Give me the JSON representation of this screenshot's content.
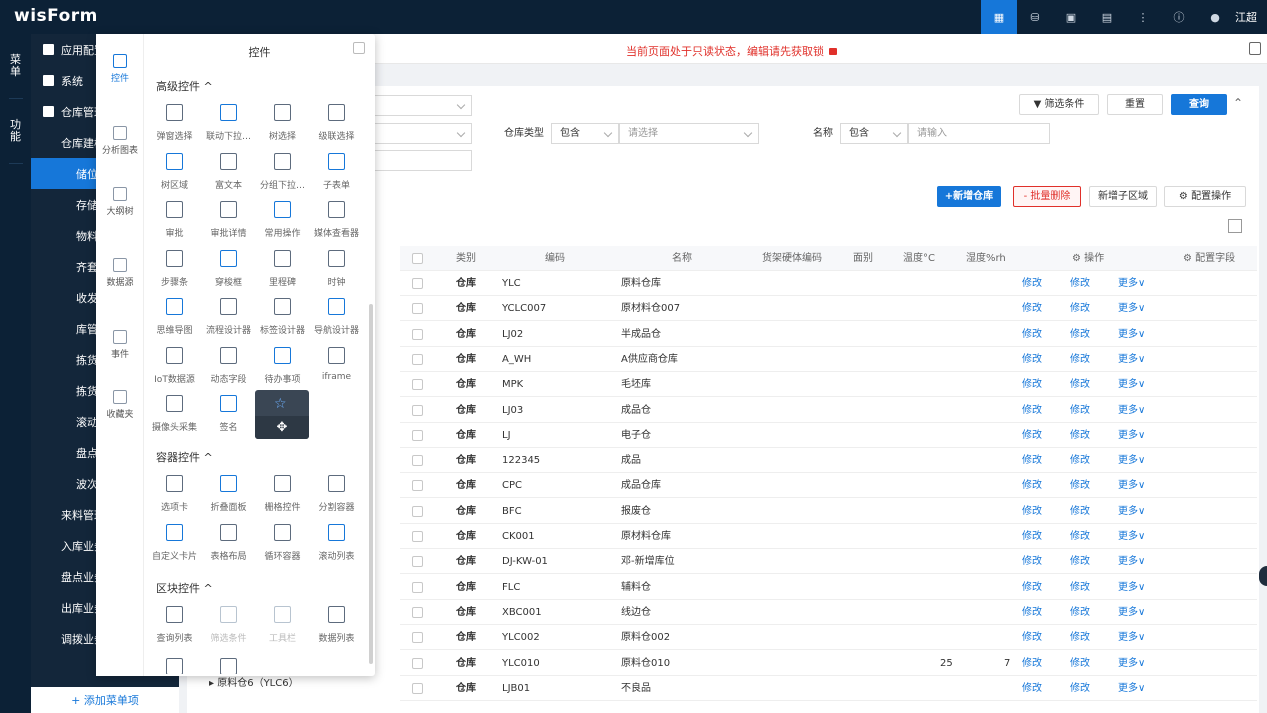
{
  "app": {
    "logo_main": "wis",
    "logo_second": "Form",
    "user_name": "江超"
  },
  "leftnav": [
    {
      "label": "菜单"
    },
    {
      "label": "功能"
    }
  ],
  "sidemenu": {
    "items": [
      {
        "label": "应用配置",
        "level": 1
      },
      {
        "label": "系统",
        "level": 1
      },
      {
        "label": "仓库管理",
        "level": 1
      },
      {
        "label": "仓库建模",
        "level": 2
      },
      {
        "label": "储位",
        "level": 3,
        "active": true
      },
      {
        "label": "存储",
        "level": 3
      },
      {
        "label": "物料",
        "level": 3
      },
      {
        "label": "齐套",
        "level": 3
      },
      {
        "label": "收发",
        "level": 3
      },
      {
        "label": "库管",
        "level": 3
      },
      {
        "label": "拣货",
        "level": 3
      },
      {
        "label": "拣货",
        "level": 3
      },
      {
        "label": "滚动",
        "level": 3
      },
      {
        "label": "盘点",
        "level": 3
      },
      {
        "label": "波次",
        "level": 3
      },
      {
        "label": "来料管理",
        "level": 2
      },
      {
        "label": "入库业务",
        "level": 2
      },
      {
        "label": "盘点业务",
        "level": 2
      },
      {
        "label": "出库业务",
        "level": 2
      },
      {
        "label": "调拨业务",
        "level": 2
      }
    ],
    "add_label": "+ 添加菜单项"
  },
  "readonly_message": "当前页面处于只读状态，编辑请先获取锁",
  "search": {
    "warehouse_type_label": "仓库类型",
    "warehouse_type_op": "包含",
    "warehouse_type_placeholder": "请选择",
    "name_label": "名称",
    "name_op": "包含",
    "name_placeholder": "请输入",
    "filter_button": "筛选条件",
    "reset_button": "重置",
    "query_button": "查询"
  },
  "toolbar": {
    "new_warehouse": "+新增仓库",
    "batch_delete": "- 批量删除",
    "new_sub_area": "新增子区域",
    "config_ops": "配置操作"
  },
  "table": {
    "headers": [
      "类别",
      "编码",
      "名称",
      "货架硬体编码",
      "面别",
      "温度°C",
      "湿度%rh",
      "操作",
      "配置字段"
    ],
    "action_edit": "修改",
    "action_more": "更多",
    "rows": [
      {
        "type": "仓库",
        "code": "YLC",
        "name": "原料仓库",
        "temp": "",
        "hum": ""
      },
      {
        "type": "仓库",
        "code": "YCLC007",
        "name": "原材料仓007",
        "temp": "",
        "hum": ""
      },
      {
        "type": "仓库",
        "code": "LJ02",
        "name": "半成品仓",
        "temp": "",
        "hum": ""
      },
      {
        "type": "仓库",
        "code": "A_WH",
        "name": "A供应商仓库",
        "temp": "",
        "hum": ""
      },
      {
        "type": "仓库",
        "code": "MPK",
        "name": "毛坯库",
        "temp": "",
        "hum": ""
      },
      {
        "type": "仓库",
        "code": "LJ03",
        "name": "成品仓",
        "temp": "",
        "hum": ""
      },
      {
        "type": "仓库",
        "code": "LJ",
        "name": "电子仓",
        "temp": "",
        "hum": ""
      },
      {
        "type": "仓库",
        "code": "122345",
        "name": "成品",
        "temp": "",
        "hum": ""
      },
      {
        "type": "仓库",
        "code": "CPC",
        "name": "成品仓库",
        "temp": "",
        "hum": ""
      },
      {
        "type": "仓库",
        "code": "BFC",
        "name": "报废仓",
        "temp": "",
        "hum": ""
      },
      {
        "type": "仓库",
        "code": "CK001",
        "name": "原材料仓库",
        "temp": "",
        "hum": ""
      },
      {
        "type": "仓库",
        "code": "DJ-KW-01",
        "name": "邓-新增库位",
        "temp": "",
        "hum": ""
      },
      {
        "type": "仓库",
        "code": "FLC",
        "name": "辅料仓",
        "temp": "",
        "hum": ""
      },
      {
        "type": "仓库",
        "code": "XBC001",
        "name": "线边仓",
        "temp": "",
        "hum": ""
      },
      {
        "type": "仓库",
        "code": "YLC002",
        "name": "原料仓002",
        "temp": "",
        "hum": ""
      },
      {
        "type": "仓库",
        "code": "YLC010",
        "name": "原料仓010",
        "temp": "25",
        "hum": "7"
      },
      {
        "type": "仓库",
        "code": "LJB01",
        "name": "不良品",
        "temp": "",
        "hum": ""
      }
    ]
  },
  "tree_item": "原料仓6（YLC6）",
  "popover": {
    "title": "控件",
    "left_tabs": [
      {
        "label": "控件",
        "active": true
      },
      {
        "label": "分析图表"
      },
      {
        "label": "大纲树"
      },
      {
        "label": "数据源"
      },
      {
        "label": "事件"
      },
      {
        "label": "收藏夹"
      }
    ],
    "sections": [
      {
        "title": "高级控件 ^",
        "items": [
          "弹窗选择",
          "联动下拉…",
          "树选择",
          "级联选择",
          "树区域",
          "富文本",
          "分组下拉…",
          "子表单",
          "审批",
          "审批详情",
          "常用操作",
          "媒体查看器",
          "步骤条",
          "穿梭框",
          "里程碑",
          "时钟",
          "思维导图",
          "流程设计器",
          "标签设计器",
          "导航设计器",
          "IoT数据源",
          "动态字段",
          "待办事项",
          "iframe",
          "摄像头采集",
          "签名"
        ]
      },
      {
        "title": "容器控件 ^",
        "items": [
          "选项卡",
          "折叠面板",
          "栅格控件",
          "分割容器",
          "自定义卡片",
          "表格布局",
          "循环容器",
          "滚动列表"
        ]
      },
      {
        "title": "区块控件 ^",
        "items": [
          "查询列表",
          "筛选条件",
          "工具栏",
          "数据列表"
        ]
      }
    ]
  }
}
